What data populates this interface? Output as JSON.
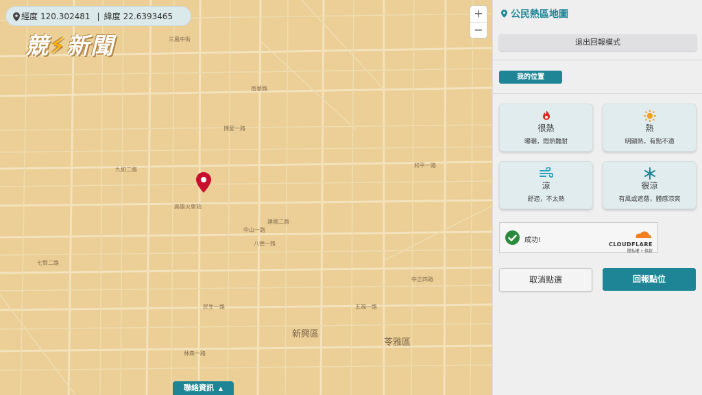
{
  "map": {
    "coords": {
      "lng_label": "經度",
      "lng_value": "120.302481",
      "separator": "|",
      "lat_label": "緯度",
      "lat_value": "22.6393465"
    },
    "zoom_in": "+",
    "zoom_out": "−",
    "contact_label": "聯絡資訊",
    "labels": {
      "xinxing": "新興區",
      "lingya": "苓雅區",
      "station": "高雄火車站",
      "nanhua": "南華路",
      "jiuru": "九如二路",
      "sanfeng": "三鳳中街",
      "jianguo": "建國二路",
      "zhongshan": "中山一路",
      "qixian": "七賢二路",
      "heping": "和平一路",
      "wufu": "五福一路",
      "minsheng": "民生一路",
      "zhongzheng": "中正四路",
      "bade": "八德一路",
      "boai": "博愛一路",
      "linsen": "林森一路"
    },
    "brand": {
      "text1": "競",
      "bolt": "⚡",
      "text2": "新聞"
    }
  },
  "panel": {
    "title": "公民熱區地圖",
    "exit_label": "退出回報模式",
    "my_location_label": "我的位置",
    "options": [
      {
        "label": "很熱",
        "desc": "曝曬，悶熱難耐",
        "icon": "flame-icon"
      },
      {
        "label": "熱",
        "desc": "明顯熱，有點不適",
        "icon": "sun-icon"
      },
      {
        "label": "涼",
        "desc": "舒適，不太熱",
        "icon": "wind-icon"
      },
      {
        "label": "很涼",
        "desc": "有風或遮蔭，體感涼爽",
        "icon": "snowflake-icon"
      }
    ],
    "captcha": {
      "status": "成功!",
      "brand": "CLOUDFLARE",
      "links": "隱私權 • 條款"
    },
    "cancel_label": "取消點選",
    "report_label": "回報點位"
  },
  "colors": {
    "accent": "#1e8596",
    "map_bg": "#ebcf96",
    "marker": "#c8102e"
  }
}
